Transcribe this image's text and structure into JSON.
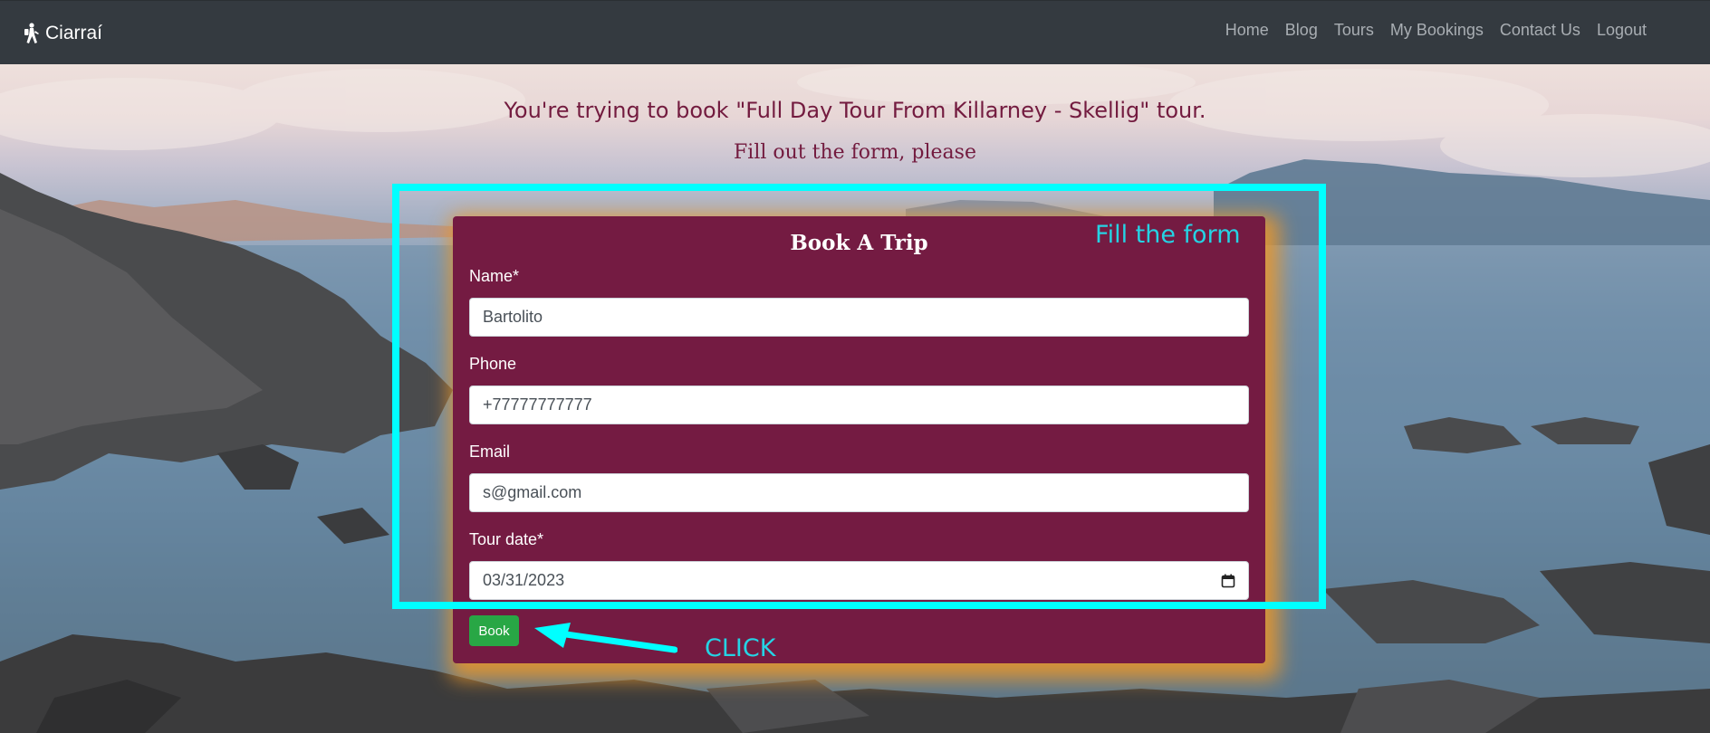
{
  "navbar": {
    "brand": "Ciarraí",
    "brand_icon": "hiker-icon",
    "links": [
      "Home",
      "Blog",
      "Tours",
      "My Bookings",
      "Contact Us",
      "Logout"
    ]
  },
  "page": {
    "title": "You're trying to book \"Full Day Tour From Killarney - Skellig\" tour.",
    "subtitle": "Fill out the form, please"
  },
  "form": {
    "title": "Book A Trip",
    "name_label": "Name*",
    "name_value": "Bartolito",
    "phone_label": "Phone",
    "phone_value": "+77777777777",
    "email_label": "Email",
    "email_value": "s@gmail.com",
    "date_label": "Tour date*",
    "date_value": "03/31/2023",
    "date_icon": "calendar-icon",
    "submit_label": "Book"
  },
  "annotations": {
    "box_note": "Fill the form",
    "button_note": "CLICK"
  },
  "colors": {
    "navbar": "#343a40",
    "card": "#741b42",
    "heading": "#731b3f",
    "button": "#28a745",
    "annotation": "#00ffff",
    "card_glow": "#ec9628"
  }
}
